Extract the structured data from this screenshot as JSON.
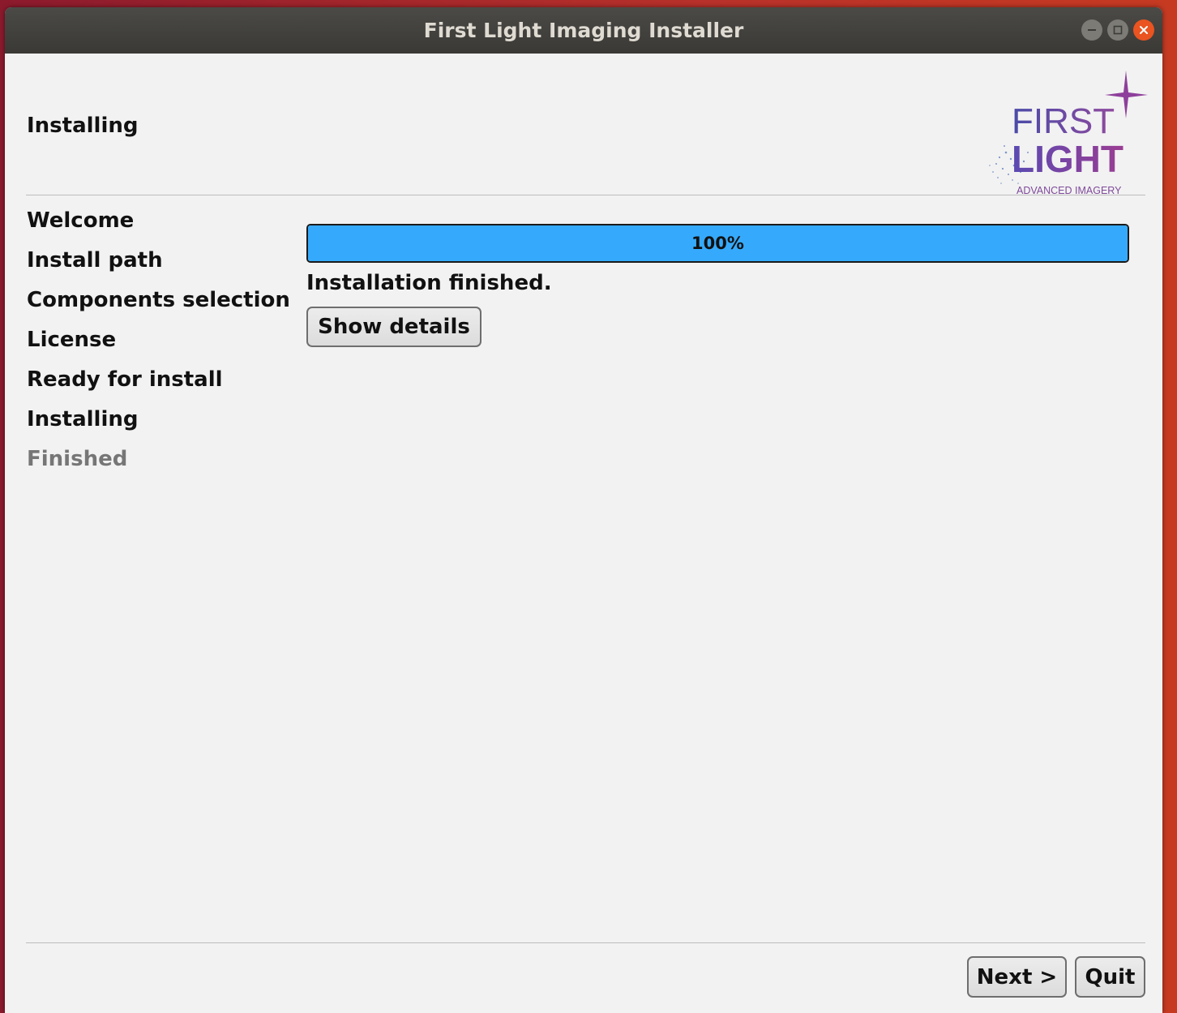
{
  "window": {
    "title": "First Light Imaging Installer"
  },
  "header": {
    "page_title": "Installing",
    "logo": {
      "line1": "FIRST",
      "line2": "LIGHT",
      "tagline": "ADVANCED IMAGERY"
    }
  },
  "sidebar": {
    "steps": [
      {
        "label": "Welcome",
        "state": "done"
      },
      {
        "label": "Install path",
        "state": "done"
      },
      {
        "label": "Components selection",
        "state": "done"
      },
      {
        "label": "License",
        "state": "done"
      },
      {
        "label": "Ready for install",
        "state": "done"
      },
      {
        "label": "Installing",
        "state": "current"
      },
      {
        "label": "Finished",
        "state": "pending"
      }
    ]
  },
  "main": {
    "progress_value": 100,
    "progress_label": "100%",
    "progress_color": "#35aafd",
    "status_text": "Installation finished.",
    "details_button": "Show details"
  },
  "footer": {
    "next_button": "Next >",
    "quit_button": "Quit"
  }
}
